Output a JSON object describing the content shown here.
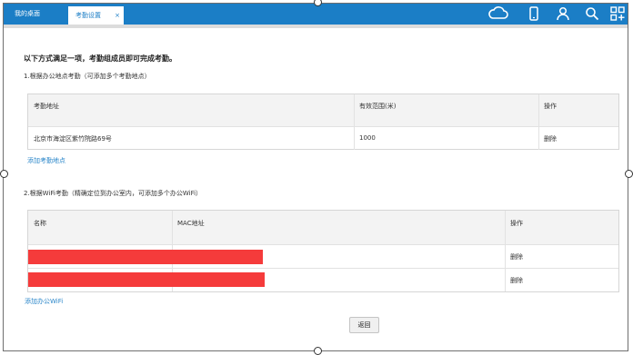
{
  "tabs": [
    {
      "label": "我的桌面"
    },
    {
      "label": "考勤设置",
      "close": "×"
    }
  ],
  "toolbar_icons": [
    "cloud-icon",
    "mobile-icon",
    "user-icon",
    "search-icon",
    "apps-icon"
  ],
  "heading": "以下方式满足一项，考勤组成员即可完成考勤。",
  "location_section": {
    "title": "1.根据办公地点考勤（可添加多个考勤地点）",
    "columns": [
      "考勤地址",
      "有效范围(米)",
      "操作"
    ],
    "rows": [
      {
        "address": "北京市海淀区紫竹院路69号",
        "range": "1000",
        "action": "删除"
      }
    ],
    "add_link": "添加考勤地点"
  },
  "wifi_section": {
    "title": "2.根据WiFi考勤（精确定位到办公室内，可添加多个办公WiFi）",
    "columns": [
      "名称",
      "MAC地址",
      "操作"
    ],
    "rows": [
      {
        "name": "",
        "mac": "",
        "action": "删除",
        "redacted": true
      },
      {
        "name": "",
        "mac": "",
        "action": "删除",
        "redacted": true
      }
    ],
    "add_link": "添加办公WiFi"
  },
  "back_button": "返回",
  "colors": {
    "brand": "#1b7ec6",
    "link": "#2a86c9",
    "redaction": "#f53b3b"
  }
}
